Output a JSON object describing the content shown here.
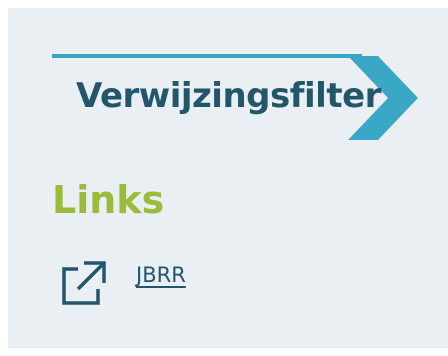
{
  "banner": {
    "title": "Verwijzingsfilter",
    "accent_color": "#3aa7c6",
    "text_color": "#23566a"
  },
  "links_section": {
    "heading": "Links",
    "heading_color": "#9bbb3b",
    "items": [
      {
        "label": "JBRR",
        "icon": "external-link-icon"
      }
    ]
  },
  "background_color": "#e9eff2"
}
